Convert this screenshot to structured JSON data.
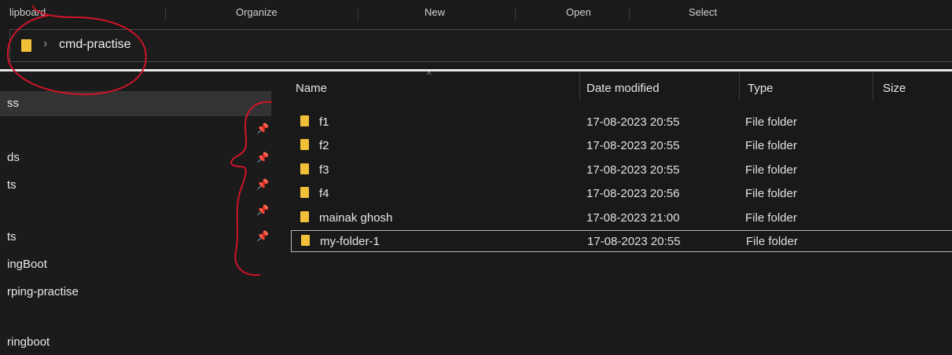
{
  "ribbon": {
    "groups": [
      "lipboard",
      "Organize",
      "New",
      "Open",
      "Select"
    ]
  },
  "address": {
    "path": "cmd-practise",
    "separator": "›"
  },
  "nav": {
    "items": [
      {
        "label": "ss",
        "selected": true
      },
      {
        "label": "",
        "pinned": true
      },
      {
        "label": "ds",
        "pinned": true
      },
      {
        "label": "ts",
        "pinned": true
      },
      {
        "label": "",
        "pinned": true
      },
      {
        "label": "ts",
        "pinned": true
      },
      {
        "label": "ingBoot"
      },
      {
        "label": "rping-practise"
      },
      {
        "label": ""
      },
      {
        "label": "ringboot"
      }
    ],
    "pin_glyph": "📌"
  },
  "columns": {
    "name": "Name",
    "date": "Date modified",
    "type": "Type",
    "size": "Size",
    "sort_glyph": "^"
  },
  "files": [
    {
      "name": "f1",
      "date": "17-08-2023 20:55",
      "type": "File folder"
    },
    {
      "name": "f2",
      "date": "17-08-2023 20:55",
      "type": "File folder"
    },
    {
      "name": "f3",
      "date": "17-08-2023 20:55",
      "type": "File folder"
    },
    {
      "name": "f4",
      "date": "17-08-2023 20:56",
      "type": "File folder"
    },
    {
      "name": "mainak ghosh",
      "date": "17-08-2023 21:00",
      "type": "File folder"
    },
    {
      "name": "my-folder-1",
      "date": "17-08-2023 20:55",
      "type": "File folder",
      "selected": true
    }
  ],
  "colors": {
    "annotation": "#d0142a",
    "folder": "#f2c038"
  }
}
